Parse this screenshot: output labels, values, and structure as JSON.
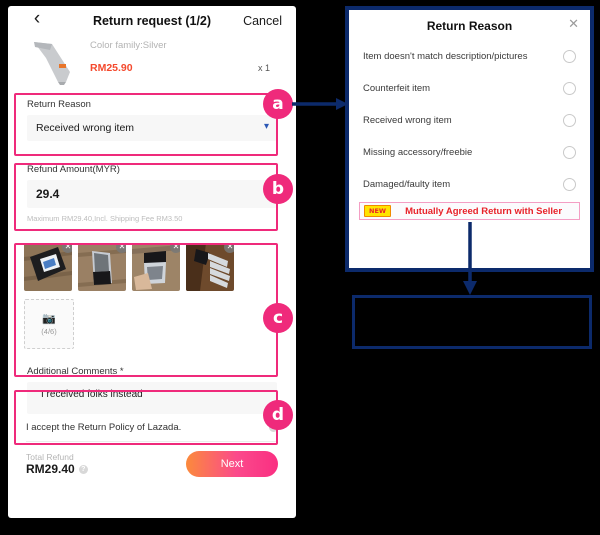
{
  "phone": {
    "nav": {
      "back_icon": "chevron-left-icon",
      "title": "Return request (1/2)",
      "cancel_label": "Cancel"
    },
    "product": {
      "color_family": "Color family:Silver",
      "price": "RM25.90",
      "quantity": "x 1"
    },
    "return_reason": {
      "label": "Return Reason",
      "value": "Received wrong item",
      "chevron_icon": "chevron-down-icon"
    },
    "refund_amount": {
      "label": "Refund Amount(MYR)",
      "value": "29.4",
      "hint": "Maximum RM29.40,Incl. Shipping Fee RM3.50"
    },
    "photos": {
      "count_label": "(4/6)",
      "camera_icon": "camera-icon",
      "remove_icon": "close-icon",
      "items": [
        {
          "alt": "photo-1"
        },
        {
          "alt": "photo-2"
        },
        {
          "alt": "photo-3"
        },
        {
          "alt": "photo-4"
        }
      ]
    },
    "comments": {
      "label": "Additional Comments *",
      "value": "I received folks instead"
    },
    "policy": {
      "text": "I accept the Return Policy of Lazada.",
      "info_icon": "info-icon"
    },
    "footer": {
      "total_label": "Total Refund",
      "total_amount": "RM29.40",
      "info_icon": "info-icon",
      "next_label": "Next"
    }
  },
  "markers": {
    "a": "a",
    "b": "b",
    "c": "c",
    "d": "d"
  },
  "dialog": {
    "title": "Return Reason",
    "close_icon": "close-icon",
    "options": [
      {
        "label": "Item doesn't match description/pictures"
      },
      {
        "label": "Counterfeit item"
      },
      {
        "label": "Received wrong item"
      },
      {
        "label": "Missing accessory/freebie"
      },
      {
        "label": "Damaged/faulty item"
      }
    ],
    "highlighted_option": {
      "badge": "NEW",
      "label": "Mutually Agreed Return with Seller"
    }
  },
  "colors": {
    "highlight_pink": "#ef2a7b",
    "arrow_navy": "#0c2a6b",
    "accent_red": "#e8232a",
    "badge_yellow": "#ffe400",
    "price_red": "#f4492d"
  }
}
